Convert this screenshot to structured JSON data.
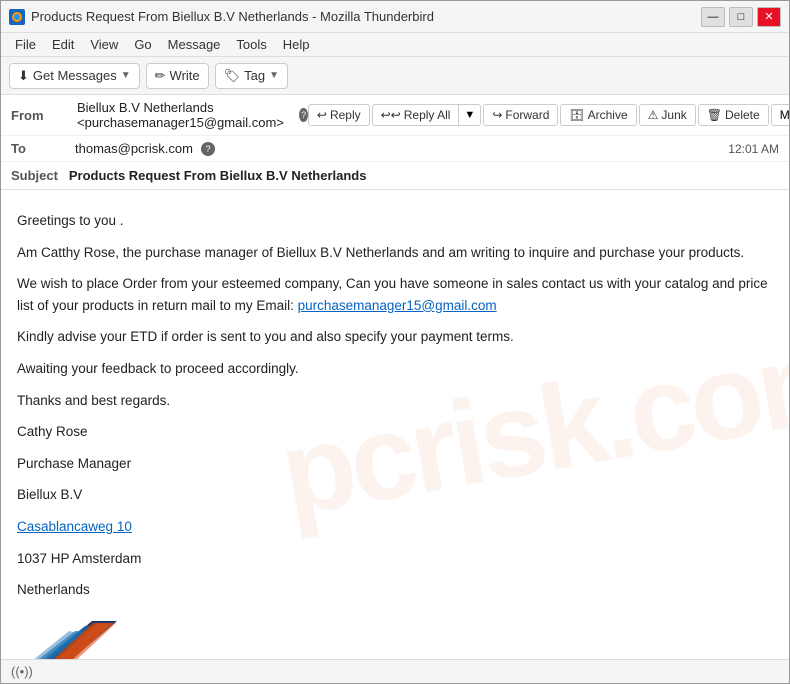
{
  "window": {
    "title": "Products Request From Biellux B.V Netherlands - Mozilla Thunderbird",
    "icon": "thunderbird"
  },
  "titlebar": {
    "minimize": "—",
    "maximize": "□",
    "close": "✕"
  },
  "menu": {
    "items": [
      "File",
      "Edit",
      "View",
      "Go",
      "Message",
      "Tools",
      "Help"
    ]
  },
  "toolbar": {
    "get_messages": "Get Messages",
    "write": "Write",
    "tag": "Tag"
  },
  "email": {
    "from_label": "From",
    "from_name": "Biellux B.V Netherlands",
    "from_email": "purchasemanager15@gmail.com",
    "to_label": "To",
    "to_email": "thomas@pcrisk.com",
    "subject_label": "Subject",
    "subject": "Products Request From Biellux B.V Netherlands",
    "timestamp": "12:01 AM"
  },
  "actions": {
    "reply": "Reply",
    "reply_all": "Reply All",
    "forward": "Forward",
    "archive": "Archive",
    "junk": "Junk",
    "delete": "Delete",
    "more": "More"
  },
  "body": {
    "greeting": "Greetings to you .",
    "para1": "Am Catthy Rose, the purchase manager of Biellux B.V Netherlands and am writing to inquire and purchase your products.",
    "para2_prefix": "We wish to place Order from your esteemed company, Can you have someone in sales contact us with your catalog and price list of your products in return mail to my Email: ",
    "para2_link": "purchasemanager15@gmail.com",
    "para3": "Kindly advise your ETD if order is sent to you and also specify your payment terms.",
    "para4": "Awaiting your feedback to proceed accordingly.",
    "para5": "Thanks and best regards.",
    "sig1": "Cathy Rose",
    "sig2": "Purchase Manager",
    "sig3": "Biellux B.V",
    "sig4_link": "Casablancaweg 10",
    "sig5": "1037 HP Amsterdam",
    "sig6": "Netherlands"
  },
  "statusbar": {
    "signal": "((•))"
  }
}
